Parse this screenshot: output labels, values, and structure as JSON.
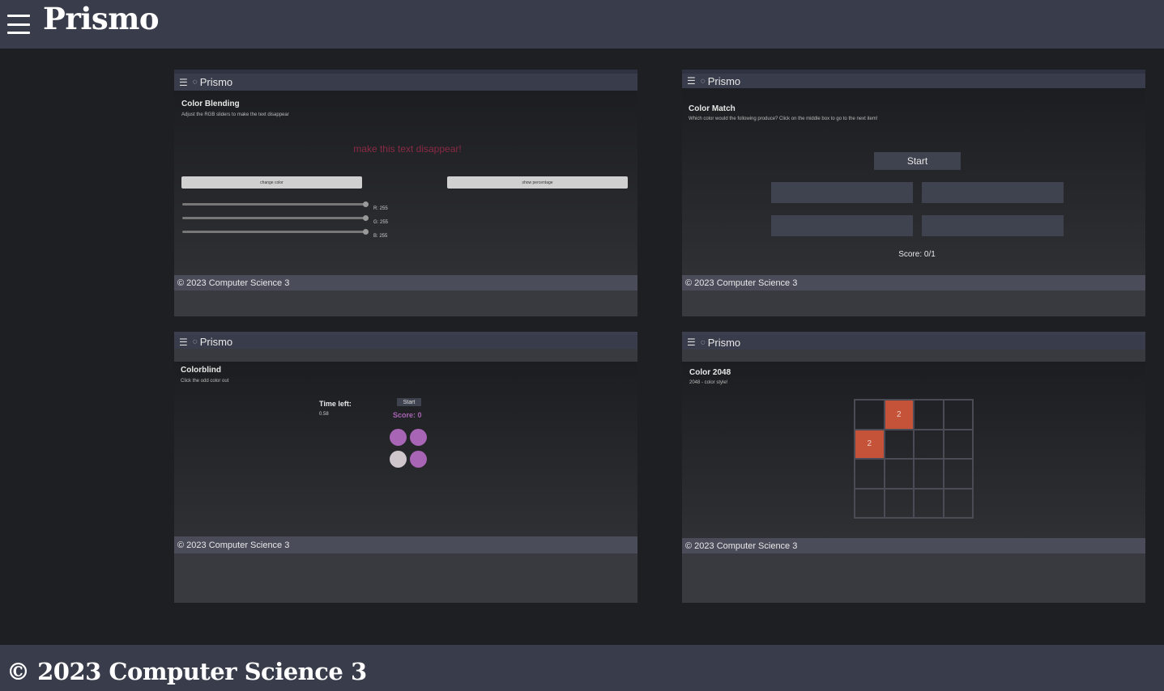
{
  "header": {
    "title": "Prismo"
  },
  "footer": {
    "text": "© 2023 Computer Science 3"
  },
  "mini": {
    "brand": "Prismo",
    "footer": "© 2023 Computer Science 3"
  },
  "cards": {
    "color_blending": {
      "title": "Color Blending",
      "subtitle": "Adjust the RGB sliders to make the text disappear",
      "target_text": "make this text disappear!",
      "change_color_label": "change color",
      "show_percentage_label": "show percentage",
      "sliders": {
        "r": "R: 255",
        "g": "G: 255",
        "b": "B: 255"
      }
    },
    "color_match": {
      "title": "Color Match",
      "subtitle": "Which color would the following produce? Click on the middle box to go to the next item!",
      "start_label": "Start",
      "score": "Score: 0/1"
    },
    "colorblind": {
      "title": "Colorblind",
      "subtitle": "Click the odd color out",
      "time_label": "Time left:",
      "time_value": "0.58",
      "start_label": "Start",
      "score": "Score: 0",
      "circle_colors": [
        "#a865b5",
        "#a865b5",
        "#cfc6cc",
        "#a865b5"
      ]
    },
    "color_2048": {
      "title": "Color 2048",
      "subtitle": "2048 - color style!",
      "tiles": [
        "",
        "2",
        "",
        "",
        "2",
        "",
        "",
        "",
        "",
        "",
        "",
        "",
        "",
        "",
        "",
        ""
      ]
    }
  },
  "colors": {
    "nav": "#393c4a",
    "background": "#1e1f23",
    "tile": "#c5533a",
    "target_text": "#8a2a44",
    "score_purple": "#a865b5"
  }
}
